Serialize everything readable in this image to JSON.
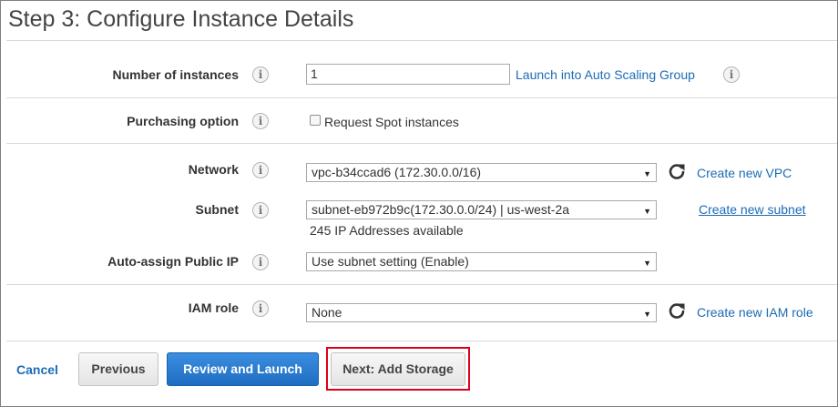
{
  "page": {
    "title": "Step 3: Configure Instance Details"
  },
  "fields": {
    "instances": {
      "label": "Number of instances",
      "value": "1",
      "link": "Launch into Auto Scaling Group"
    },
    "purchasing": {
      "label": "Purchasing option",
      "checkbox_label": "Request Spot instances",
      "checked": false
    },
    "network": {
      "label": "Network",
      "selected": "vpc-b34ccad6 (172.30.0.0/16)",
      "link": "Create new VPC"
    },
    "subnet": {
      "label": "Subnet",
      "selected": "subnet-eb972b9c(172.30.0.0/24) | us-west-2a",
      "note": "245 IP Addresses available",
      "link": "Create new subnet"
    },
    "public_ip": {
      "label": "Auto-assign Public IP",
      "selected": "Use subnet setting (Enable)"
    },
    "iam_role": {
      "label": "IAM role",
      "selected": "None",
      "link": "Create new IAM role"
    }
  },
  "icons": {
    "info": "info-icon",
    "refresh": "refresh-icon",
    "dropdown": "chevron-down-icon"
  },
  "info_glyph": "i",
  "footer": {
    "cancel": "Cancel",
    "previous": "Previous",
    "review_launch": "Review and Launch",
    "next": "Next: Add Storage"
  },
  "colors": {
    "link": "#1c6cb5",
    "primary_button": "#1f6dc2",
    "highlight": "#e0001b"
  }
}
